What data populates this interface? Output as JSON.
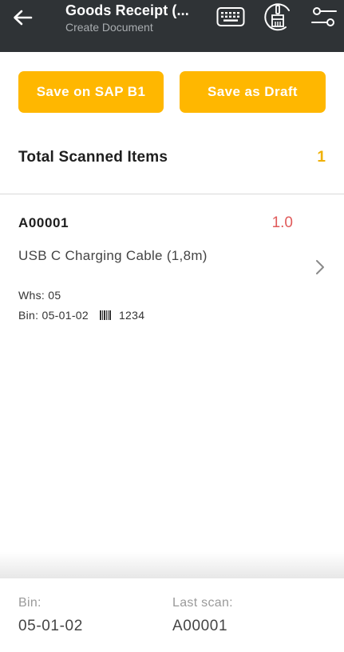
{
  "app_bar": {
    "title": "Goods Receipt (...",
    "subtitle": "Create Document",
    "back_icon": "back-arrow-icon",
    "keyboard_icon": "keyboard-icon",
    "clean_icon": "broom-icon",
    "filter_icon": "filter-settings-icon"
  },
  "actions": {
    "save_sap_label": "Save on SAP B1",
    "save_draft_label": "Save as Draft",
    "accent_color": "#ffb700"
  },
  "summary": {
    "label": "Total Scanned Items",
    "count": "1"
  },
  "items": [
    {
      "code": "A00001",
      "quantity": "1.0",
      "name": "USB C Charging Cable (1,8m)",
      "whs": "Whs: 05",
      "bin": "Bin: 05-01-02",
      "barcode": "1234"
    }
  ],
  "footer": {
    "bin_label": "Bin:",
    "bin_value": "05-01-02",
    "last_scan_label": "Last scan:",
    "last_scan_value": "A00001"
  },
  "colors": {
    "app_bar": "#2f3336",
    "quantity": "#e05a5a",
    "count": "#f0b000"
  }
}
